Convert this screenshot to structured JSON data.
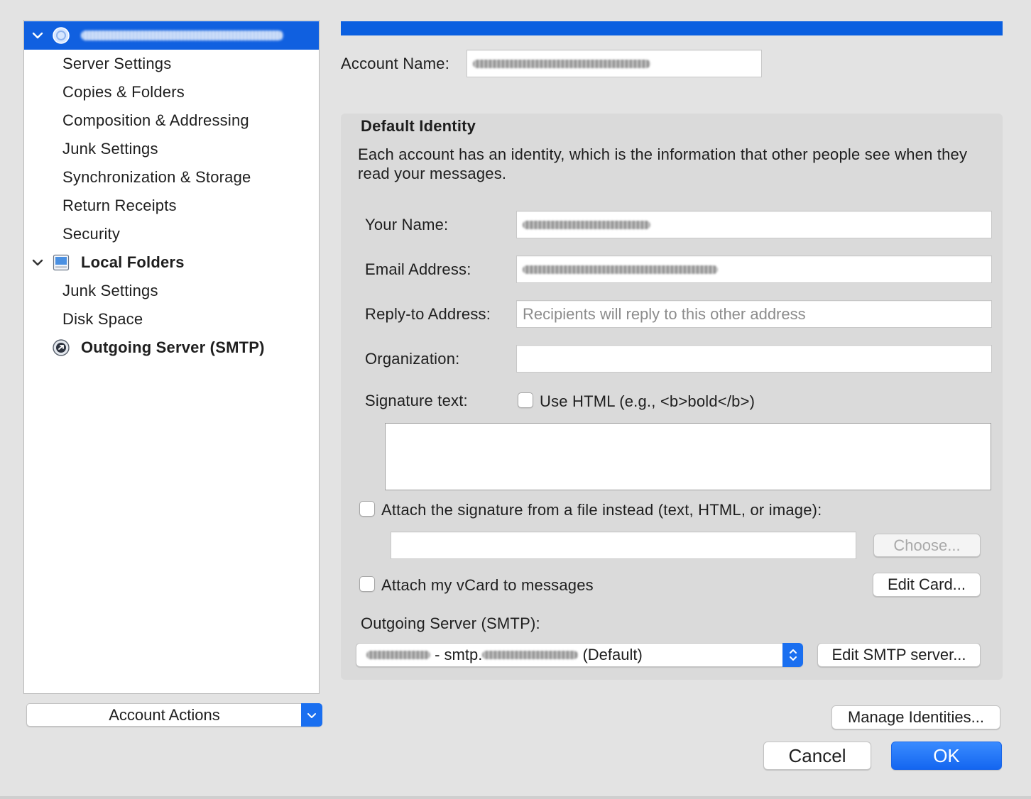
{
  "sidebar": {
    "items": [
      {
        "label": "Server Settings"
      },
      {
        "label": "Copies & Folders"
      },
      {
        "label": "Composition & Addressing"
      },
      {
        "label": "Junk Settings"
      },
      {
        "label": "Synchronization & Storage"
      },
      {
        "label": "Return Receipts"
      },
      {
        "label": "Security"
      }
    ],
    "local_folders": {
      "label": "Local Folders",
      "items": [
        {
          "label": "Junk Settings"
        },
        {
          "label": "Disk Space"
        }
      ]
    },
    "outgoing_server": {
      "label": "Outgoing Server (SMTP)"
    },
    "account_actions_label": "Account Actions"
  },
  "main": {
    "account_name_label": "Account Name:",
    "default_identity": {
      "title": "Default Identity",
      "description": "Each account has an identity, which is the information that other people see when they read your messages.",
      "your_name_label": "Your Name:",
      "email_label": "Email Address:",
      "reply_to_label": "Reply-to Address:",
      "reply_to_placeholder": "Recipients will reply to this other address",
      "organization_label": "Organization:",
      "organization_value": "",
      "signature_label": "Signature text:",
      "use_html_label": "Use HTML (e.g., <b>bold</b>)",
      "use_html_checked": false,
      "attach_file_label": "Attach the signature from a file instead (text, HTML, or image):",
      "attach_file_checked": false,
      "choose_button": "Choose...",
      "attach_vcard_label": "Attach my vCard to messages",
      "attach_vcard_checked": false,
      "edit_card_button": "Edit Card...",
      "outgoing_server_label": "Outgoing Server (SMTP):",
      "smtp_select_middle": " - smtp.",
      "smtp_select_suffix": " (Default)",
      "edit_smtp_button": "Edit SMTP server..."
    },
    "manage_identities_button": "Manage Identities...",
    "cancel_button": "Cancel",
    "ok_button": "OK"
  },
  "colors": {
    "accent": "#1060e0",
    "window_bg": "#e3e3e3",
    "group_bg": "#dadada"
  }
}
